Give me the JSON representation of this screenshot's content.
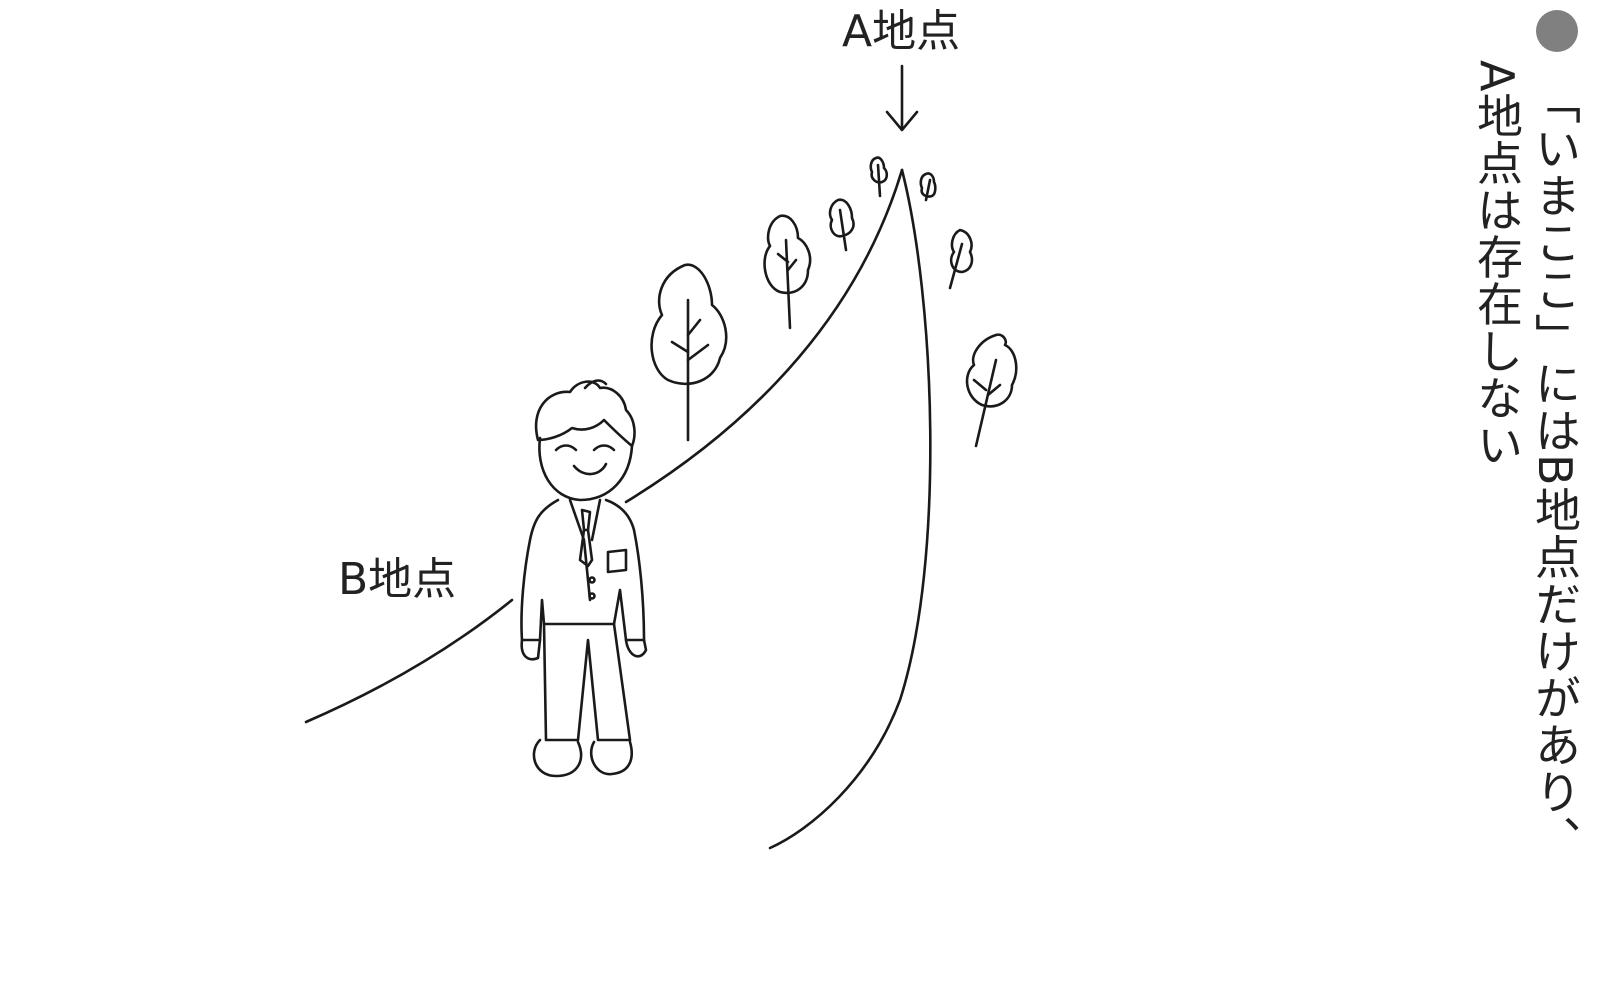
{
  "labels": {
    "point_a": "A地点",
    "point_b": "B地点"
  },
  "caption": {
    "line1": "「いまここ」にはB地点だけがあり、",
    "line2": "A地点は存在しない",
    "bullet_color": "#808080"
  },
  "icons": [
    "down-arrow-icon",
    "bullet-dot-icon"
  ]
}
